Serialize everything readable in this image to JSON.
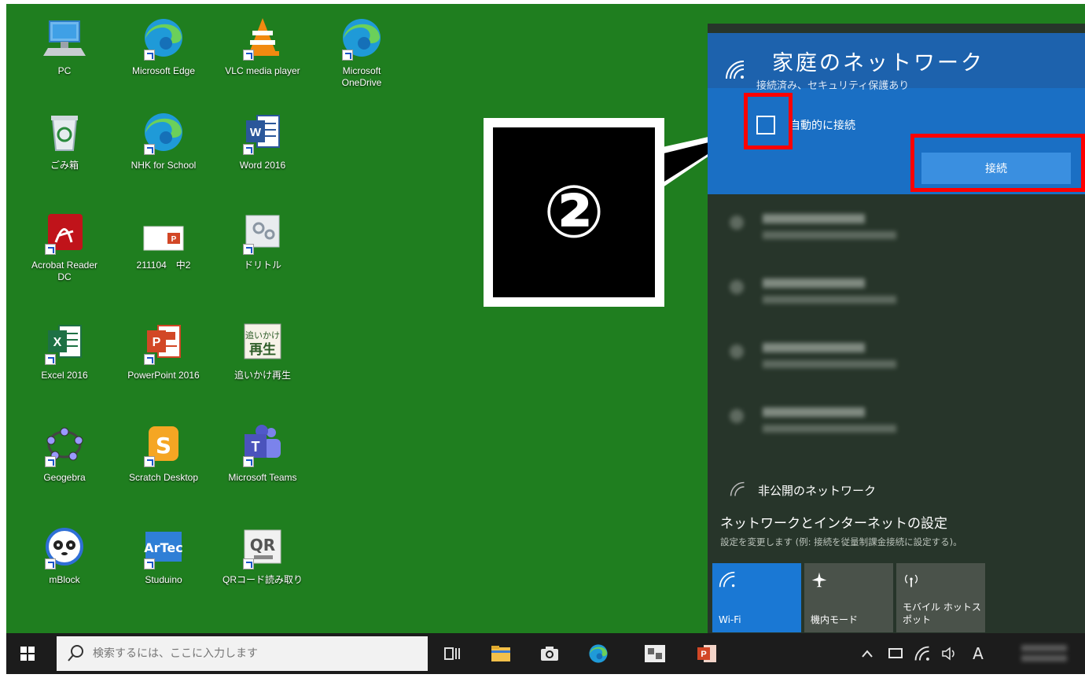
{
  "colors": {
    "desktop_bg": "#1f7e1f",
    "flyout_bg": "#27352a",
    "selected_net_bg": "#1a6fc4",
    "connect_button": "#3a8fe0",
    "highlight_red": "#ff0000",
    "taskbar_bg": "#1c1c1c"
  },
  "desktop": {
    "icons": [
      {
        "label": "PC",
        "icon": "pc-icon"
      },
      {
        "label": "Microsoft Edge",
        "icon": "edge-icon"
      },
      {
        "label": "VLC media player",
        "icon": "vlc-icon"
      },
      {
        "label": "Microsoft\nOneDrive",
        "icon": "edge-icon"
      },
      {
        "label": "ごみ箱",
        "icon": "recycle-bin-icon"
      },
      {
        "label": "NHK for School",
        "icon": "edge-icon"
      },
      {
        "label": "Word 2016",
        "icon": "word-icon"
      },
      {
        "label": "Acrobat Reader\nDC",
        "icon": "acrobat-icon"
      },
      {
        "label": "211104　中2",
        "icon": "pptx-file-icon"
      },
      {
        "label": "ドリトル",
        "icon": "dolittle-icon"
      },
      {
        "label": "Excel 2016",
        "icon": "excel-icon"
      },
      {
        "label": "PowerPoint 2016",
        "icon": "powerpoint-icon"
      },
      {
        "label": "追いかけ再生",
        "icon": "replay-icon"
      },
      {
        "label": "Geogebra",
        "icon": "geogebra-icon"
      },
      {
        "label": "Scratch Desktop",
        "icon": "scratch-icon"
      },
      {
        "label": "Microsoft Teams",
        "icon": "teams-icon"
      },
      {
        "label": "mBlock",
        "icon": "mblock-icon"
      },
      {
        "label": "Studuino",
        "icon": "studuino-icon"
      },
      {
        "label": "QRコード読み取り",
        "icon": "qr-reader-icon"
      }
    ]
  },
  "callout": {
    "text": "②"
  },
  "network_flyout": {
    "selected_network": {
      "name": "家庭のネットワーク",
      "status": "接続済み、セキュリティ保護あり",
      "auto_connect_label": "自動的に接続",
      "auto_connect_checked": false,
      "connect_button": "接続"
    },
    "hidden_network": "非公開のネットワーク",
    "settings_title": "ネットワークとインターネットの設定",
    "settings_subtitle": "設定を変更します (例: 接続を従量制課金接続に設定する)。",
    "quick_actions": [
      {
        "label": "Wi-Fi",
        "icon": "wifi-icon",
        "active": true
      },
      {
        "label": "機内モード",
        "icon": "airplane-icon",
        "active": false
      },
      {
        "label": "モバイル ホットス\nポット",
        "icon": "hotspot-icon",
        "active": false
      }
    ]
  },
  "taskbar": {
    "search_placeholder": "検索するには、ここに入力します",
    "ime_indicator": "A"
  }
}
